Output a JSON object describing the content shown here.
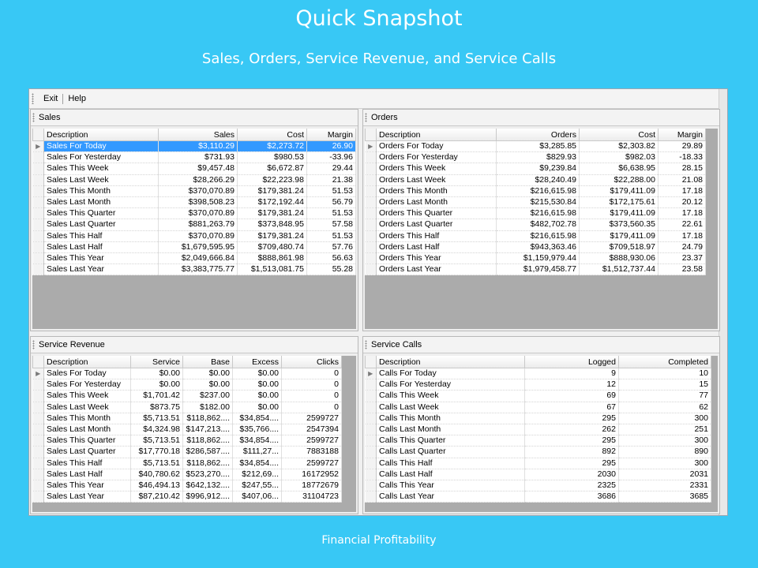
{
  "slide": {
    "title": "Quick Snapshot",
    "subtitle": "Sales, Orders, Service Revenue, and Service Calls",
    "footer": "Financial Profitability"
  },
  "menu": {
    "exit": "Exit",
    "help": "Help"
  },
  "sales": {
    "title": "Sales",
    "columns": [
      "Description",
      "Sales",
      "Cost",
      "Margin"
    ],
    "rows": [
      [
        "Sales For Today",
        "$3,110.29",
        "$2,273.72",
        "26.90"
      ],
      [
        "Sales For Yesterday",
        "$731.93",
        "$980.53",
        "-33.96"
      ],
      [
        "Sales This Week",
        "$9,457.48",
        "$6,672.87",
        "29.44"
      ],
      [
        "Sales Last Week",
        "$28,266.29",
        "$22,223.98",
        "21.38"
      ],
      [
        "Sales This Month",
        "$370,070.89",
        "$179,381.24",
        "51.53"
      ],
      [
        "Sales Last Month",
        "$398,508.23",
        "$172,192.44",
        "56.79"
      ],
      [
        "Sales This Quarter",
        "$370,070.89",
        "$179,381.24",
        "51.53"
      ],
      [
        "Sales Last Quarter",
        "$881,263.79",
        "$373,848.95",
        "57.58"
      ],
      [
        "Sales This Half",
        "$370,070.89",
        "$179,381.24",
        "51.53"
      ],
      [
        "Sales Last Half",
        "$1,679,595.95",
        "$709,480.74",
        "57.76"
      ],
      [
        "Sales This Year",
        "$2,049,666.84",
        "$888,861.98",
        "56.63"
      ],
      [
        "Sales Last Year",
        "$3,383,775.77",
        "$1,513,081.75",
        "55.28"
      ]
    ]
  },
  "orders": {
    "title": "Orders",
    "columns": [
      "Description",
      "Orders",
      "Cost",
      "Margin"
    ],
    "rows": [
      [
        "Orders For Today",
        "$3,285.85",
        "$2,303.82",
        "29.89"
      ],
      [
        "Orders For Yesterday",
        "$829.93",
        "$982.03",
        "-18.33"
      ],
      [
        "Orders This Week",
        "$9,239.84",
        "$6,638.95",
        "28.15"
      ],
      [
        "Orders Last Week",
        "$28,240.49",
        "$22,288.00",
        "21.08"
      ],
      [
        "Orders This Month",
        "$216,615.98",
        "$179,411.09",
        "17.18"
      ],
      [
        "Orders Last Month",
        "$215,530.84",
        "$172,175.61",
        "20.12"
      ],
      [
        "Orders This Quarter",
        "$216,615.98",
        "$179,411.09",
        "17.18"
      ],
      [
        "Orders Last Quarter",
        "$482,702.78",
        "$373,560.35",
        "22.61"
      ],
      [
        "Orders This Half",
        "$216,615.98",
        "$179,411.09",
        "17.18"
      ],
      [
        "Orders Last Half",
        "$943,363.46",
        "$709,518.97",
        "24.79"
      ],
      [
        "Orders This Year",
        "$1,159,979.44",
        "$888,930.06",
        "23.37"
      ],
      [
        "Orders Last Year",
        "$1,979,458.77",
        "$1,512,737.44",
        "23.58"
      ]
    ]
  },
  "service_revenue": {
    "title": "Service Revenue",
    "columns": [
      "Description",
      "Service",
      "Base",
      "Excess",
      "Clicks"
    ],
    "rows": [
      [
        "Sales For Today",
        "$0.00",
        "$0.00",
        "$0.00",
        "0"
      ],
      [
        "Sales For Yesterday",
        "$0.00",
        "$0.00",
        "$0.00",
        "0"
      ],
      [
        "Sales This Week",
        "$1,701.42",
        "$237.00",
        "$0.00",
        "0"
      ],
      [
        "Sales Last Week",
        "$873.75",
        "$182.00",
        "$0.00",
        "0"
      ],
      [
        "Sales This Month",
        "$5,713.51",
        "$118,862....",
        "$34,854....",
        "2599727"
      ],
      [
        "Sales Last Month",
        "$4,324.98",
        "$147,213....",
        "$35,766....",
        "2547394"
      ],
      [
        "Sales This Quarter",
        "$5,713.51",
        "$118,862....",
        "$34,854....",
        "2599727"
      ],
      [
        "Sales Last Quarter",
        "$17,770.18",
        "$286,587....",
        "$111,27...",
        "7883188"
      ],
      [
        "Sales This Half",
        "$5,713.51",
        "$118,862....",
        "$34,854....",
        "2599727"
      ],
      [
        "Sales Last Half",
        "$40,780.62",
        "$523,270....",
        "$212,69...",
        "16172952"
      ],
      [
        "Sales This Year",
        "$46,494.13",
        "$642,132....",
        "$247,55...",
        "18772679"
      ],
      [
        "Sales Last Year",
        "$87,210.42",
        "$996,912....",
        "$407,06...",
        "31104723"
      ]
    ]
  },
  "service_calls": {
    "title": "Service Calls",
    "columns": [
      "Description",
      "Logged",
      "Completed"
    ],
    "rows": [
      [
        "Calls For Today",
        "9",
        "10"
      ],
      [
        "Calls For Yesterday",
        "12",
        "15"
      ],
      [
        "Calls This Week",
        "69",
        "77"
      ],
      [
        "Calls Last Week",
        "67",
        "62"
      ],
      [
        "Calls This Month",
        "295",
        "300"
      ],
      [
        "Calls Last Month",
        "262",
        "251"
      ],
      [
        "Calls This Quarter",
        "295",
        "300"
      ],
      [
        "Calls Last Quarter",
        "892",
        "890"
      ],
      [
        "Calls This Half",
        "295",
        "300"
      ],
      [
        "Calls Last Half",
        "2030",
        "2031"
      ],
      [
        "Calls This Year",
        "2325",
        "2331"
      ],
      [
        "Calls Last Year",
        "3686",
        "3685"
      ]
    ]
  },
  "icons": {
    "current_row": "row-pointer-icon",
    "grip": "grip-dots-icon"
  }
}
